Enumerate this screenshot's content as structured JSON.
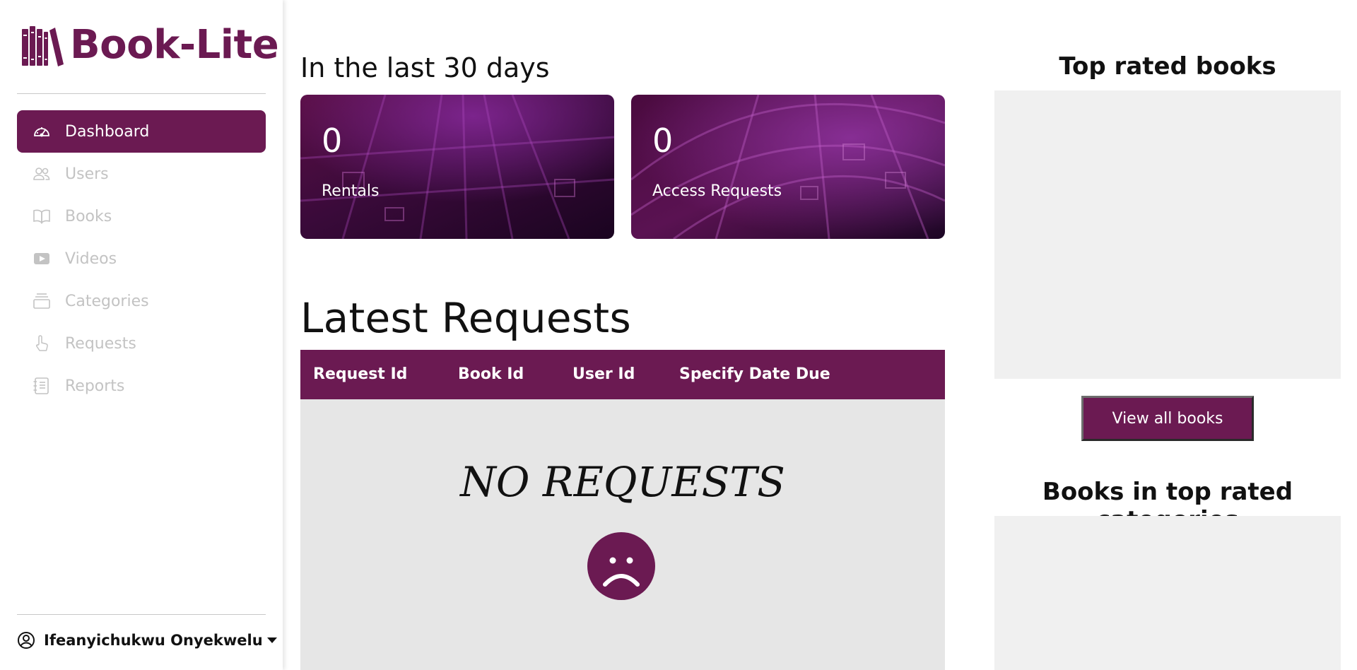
{
  "brand": {
    "name": "Book-Lite"
  },
  "nav": {
    "items": [
      {
        "label": "Dashboard",
        "icon": "speedometer-icon",
        "active": true
      },
      {
        "label": "Users",
        "icon": "users-icon"
      },
      {
        "label": "Books",
        "icon": "book-icon"
      },
      {
        "label": "Videos",
        "icon": "video-icon"
      },
      {
        "label": "Categories",
        "icon": "collection-icon"
      },
      {
        "label": "Requests",
        "icon": "hand-pointer-icon"
      },
      {
        "label": "Reports",
        "icon": "report-icon"
      }
    ]
  },
  "user": {
    "name": "Ifeanyichukwu Onyekwelu"
  },
  "stats": {
    "heading": "In the last 30 days",
    "cards": [
      {
        "count": "0",
        "label": "Rentals"
      },
      {
        "count": "0",
        "label": "Access Requests"
      }
    ]
  },
  "requests": {
    "heading": "Latest Requests",
    "columns": [
      "Request Id",
      "Book Id",
      "User Id",
      "Specify Date Due"
    ],
    "empty_text": "NO REQUESTS"
  },
  "right": {
    "top_rated_heading": "Top rated books",
    "view_all_label": "View all books",
    "categories_heading": "Books in top rated categories"
  },
  "colors": {
    "accent": "#6b1a52",
    "nav_inactive": "#c3c3c3",
    "panel_bg": "#f0f0f0",
    "table_body": "#e6e6e6"
  }
}
